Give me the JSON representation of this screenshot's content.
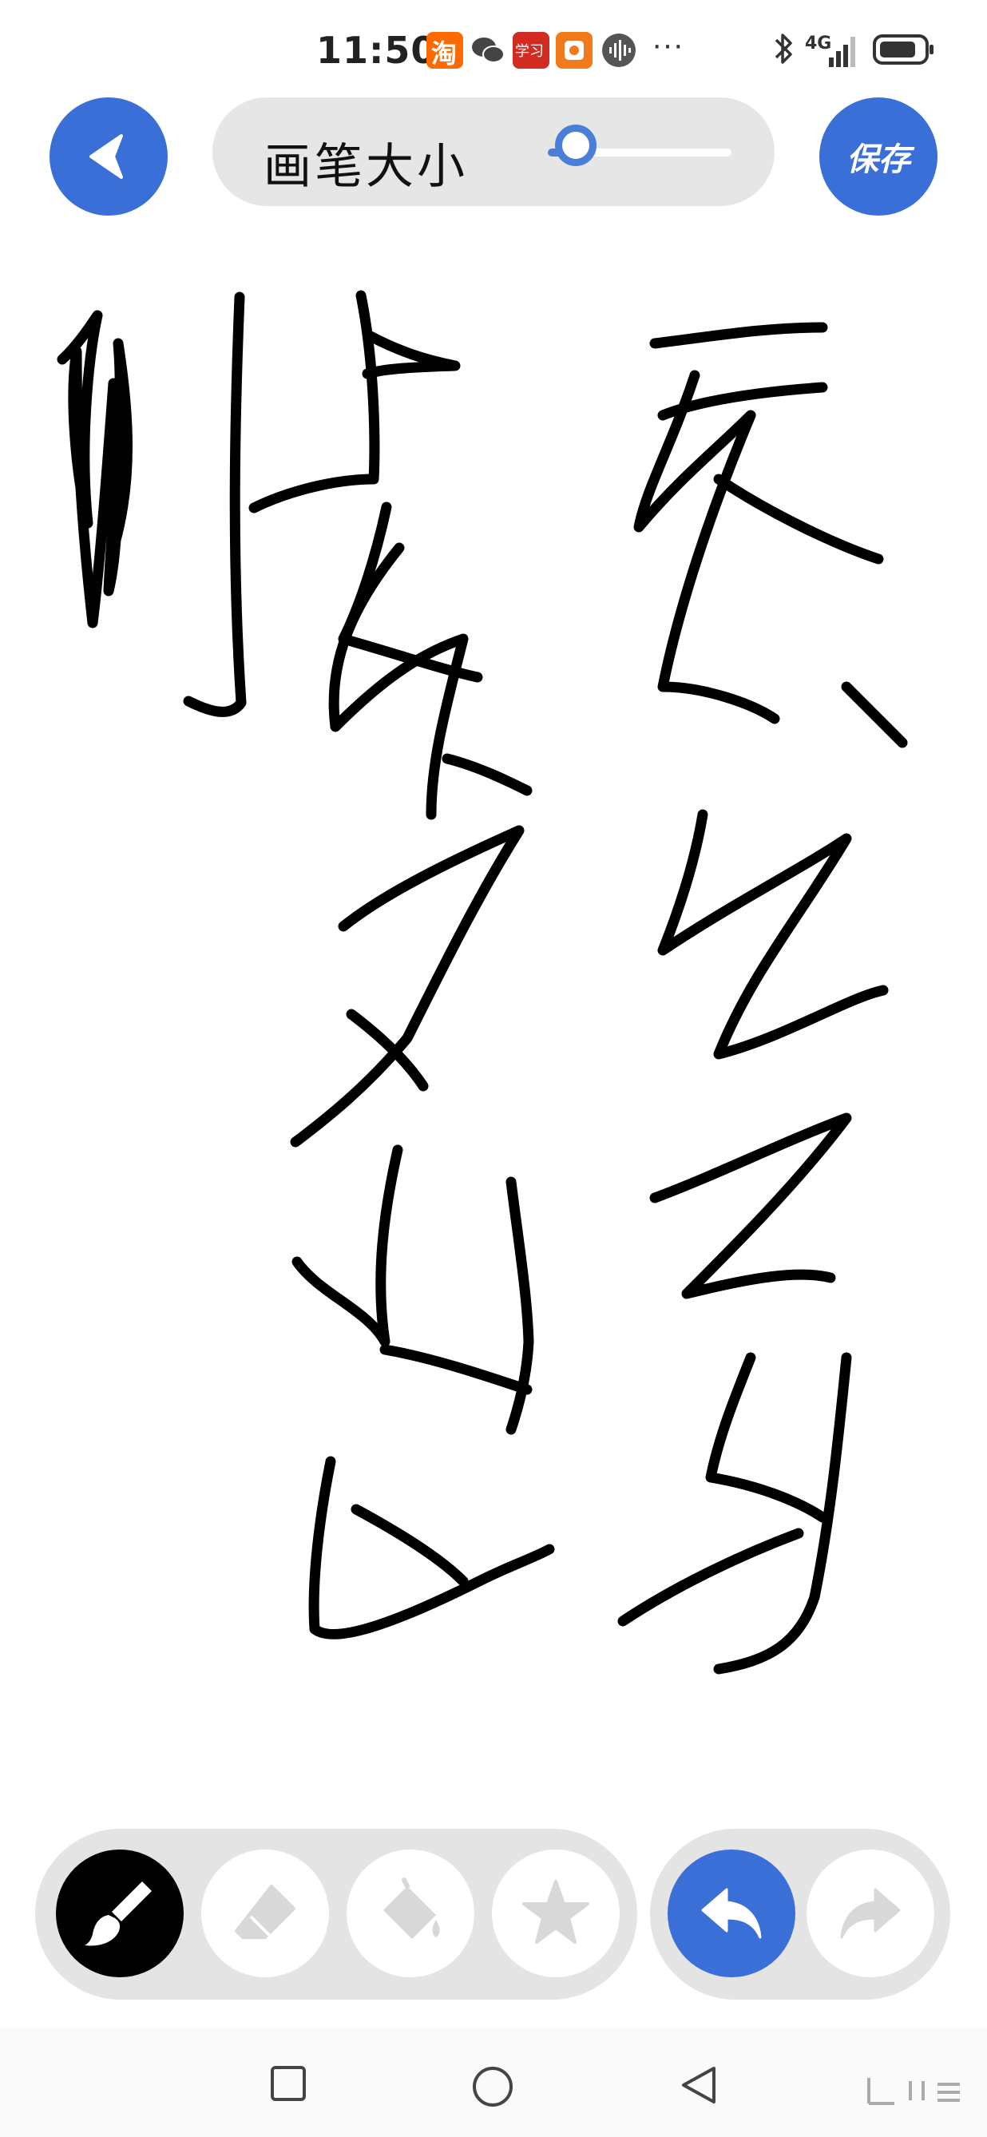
{
  "status_bar": {
    "time": "11:50",
    "network": "4G",
    "icons": [
      "taobao-icon",
      "wechat-icon",
      "xuexi-icon",
      "app-icon",
      "voice-icon",
      "more-icon",
      "bluetooth-icon",
      "signal-icon",
      "battery-icon"
    ],
    "taobao_label": "淘",
    "xuexi_label": "学习",
    "more": "···"
  },
  "header": {
    "back_icon": "back-arrow-icon",
    "brush_size_label": "画笔大小",
    "brush_size_level": 0.15,
    "save_label": "保存"
  },
  "toolbar": {
    "tools": [
      {
        "name": "brush",
        "icon": "brush-icon",
        "active": true
      },
      {
        "name": "eraser",
        "icon": "eraser-icon",
        "active": false
      },
      {
        "name": "fill",
        "icon": "paint-bucket-icon",
        "active": false
      },
      {
        "name": "sticker",
        "icon": "star-icon",
        "active": false
      }
    ],
    "history": [
      {
        "name": "undo",
        "icon": "undo-icon",
        "enabled": true
      },
      {
        "name": "redo",
        "icon": "redo-icon",
        "enabled": false
      }
    ]
  },
  "nav": {
    "icons": [
      "recent-apps-icon",
      "home-icon",
      "back-icon",
      "menu-icon"
    ]
  },
  "colors": {
    "accent": "#3a6fd8",
    "stroke": "#000000",
    "panel": "#e4e4e4"
  }
}
